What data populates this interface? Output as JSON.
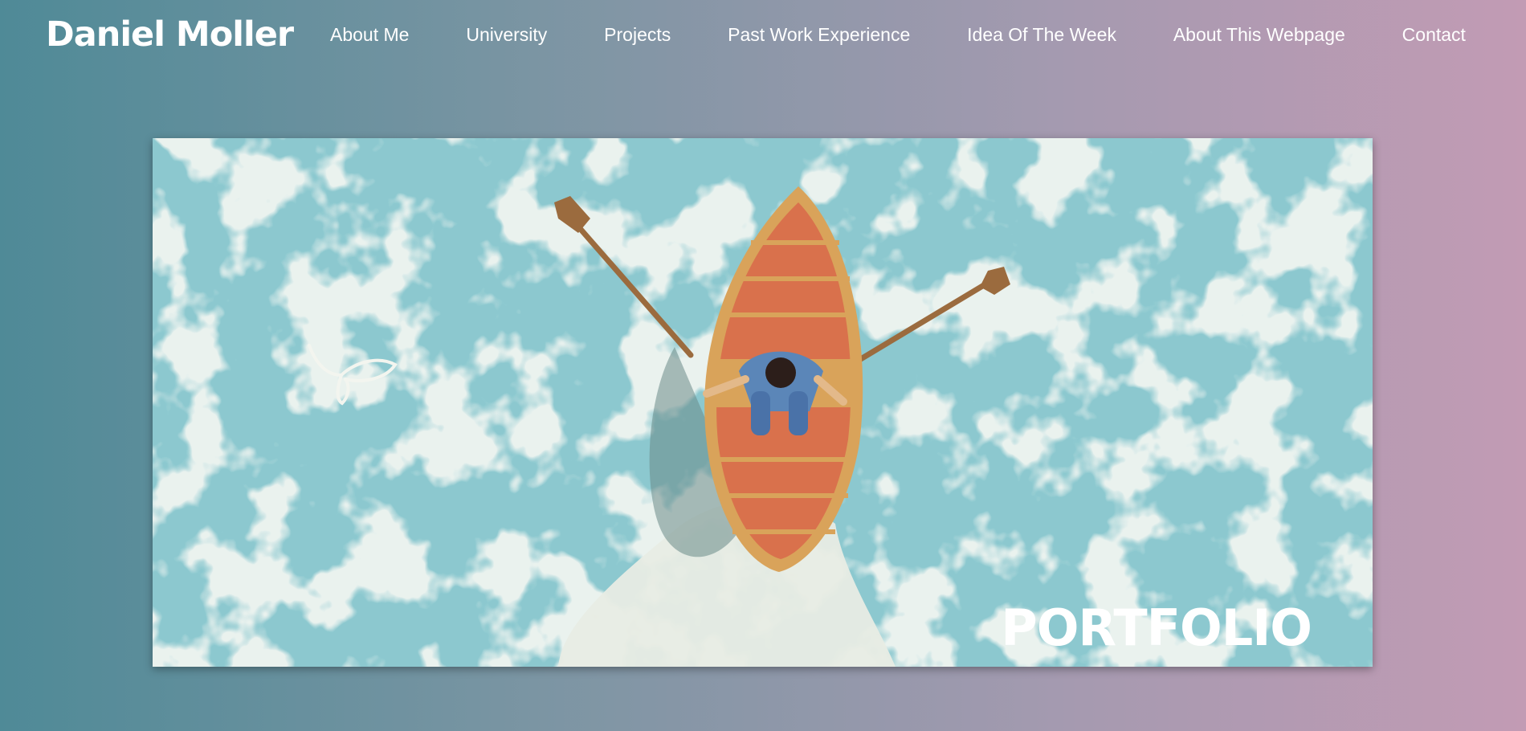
{
  "header": {
    "brand": "Daniel Moller",
    "nav": [
      {
        "label": "About Me"
      },
      {
        "label": "University"
      },
      {
        "label": "Projects"
      },
      {
        "label": "Past Work Experience"
      },
      {
        "label": "Idea Of The Week"
      },
      {
        "label": "About This Webpage"
      },
      {
        "label": "Contact"
      }
    ]
  },
  "hero": {
    "title": "PORTFOLIO",
    "illustration": "rowing-boat-from-above",
    "colors": {
      "water": "#8cc8cf",
      "foam": "#e8ece4",
      "boat_hull": "#d9a35a",
      "boat_wood": "#d9714c",
      "oar": "#9b6b3e"
    }
  }
}
